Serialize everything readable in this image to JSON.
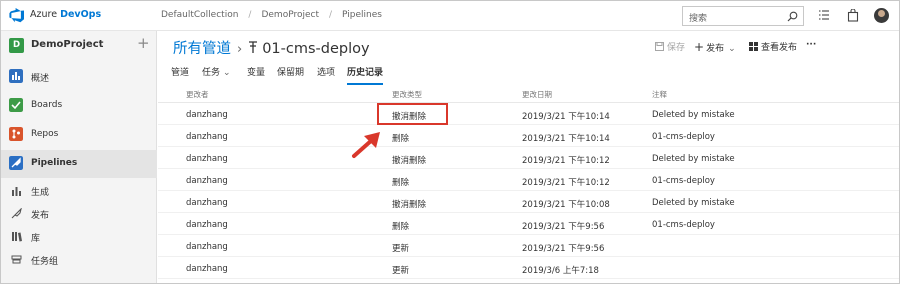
{
  "topbar": {
    "brand_plain": "Azure ",
    "brand_bold": "DevOps",
    "breadcrumbs": [
      "DefaultCollection",
      "DemoProject",
      "Pipelines"
    ],
    "search_placeholder": "搜索"
  },
  "sidebar": {
    "project_name": "DemoProject",
    "project_initial": "D",
    "items": [
      {
        "label": "概述",
        "icon": "overview-icon"
      },
      {
        "label": "Boards",
        "icon": "boards-icon"
      },
      {
        "label": "Repos",
        "icon": "repos-icon"
      },
      {
        "label": "Pipelines",
        "icon": "pipelines-icon"
      }
    ],
    "subitems": [
      {
        "label": "生成",
        "icon": "builds-icon"
      },
      {
        "label": "发布",
        "icon": "releases-icon"
      },
      {
        "label": "库",
        "icon": "library-icon"
      },
      {
        "label": "任务组",
        "icon": "task-groups-icon"
      }
    ]
  },
  "main": {
    "title_parent": "所有管道",
    "title_current": "01-cms-deploy",
    "toolbar": {
      "save": "保存",
      "release": "发布",
      "view_releases": "查看发布",
      "more": "···"
    },
    "tabs": [
      "管道",
      "任务",
      "变量",
      "保留期",
      "选项",
      "历史记录"
    ],
    "selected_tab": "历史记录"
  },
  "table": {
    "headers": [
      "更改者",
      "更改类型",
      "更改日期",
      "注释"
    ],
    "rows": [
      [
        "danzhang",
        "撤消删除",
        "2019/3/21 下午10:14",
        "Deleted by mistake"
      ],
      [
        "danzhang",
        "删除",
        "2019/3/21 下午10:14",
        "01-cms-deploy"
      ],
      [
        "danzhang",
        "撤消删除",
        "2019/3/21 下午10:12",
        "Deleted by mistake"
      ],
      [
        "danzhang",
        "删除",
        "2019/3/21 下午10:12",
        "01-cms-deploy"
      ],
      [
        "danzhang",
        "撤消删除",
        "2019/3/21 下午10:08",
        "Deleted by mistake"
      ],
      [
        "danzhang",
        "删除",
        "2019/3/21 下午9:56",
        "01-cms-deploy"
      ],
      [
        "danzhang",
        "更新",
        "2019/3/21 下午9:56",
        ""
      ],
      [
        "danzhang",
        "更新",
        "2019/3/6 上午7:18",
        ""
      ]
    ]
  },
  "colors": {
    "accent": "#0078d4",
    "annotation": "#d9372b",
    "project_badge": "#339947"
  }
}
